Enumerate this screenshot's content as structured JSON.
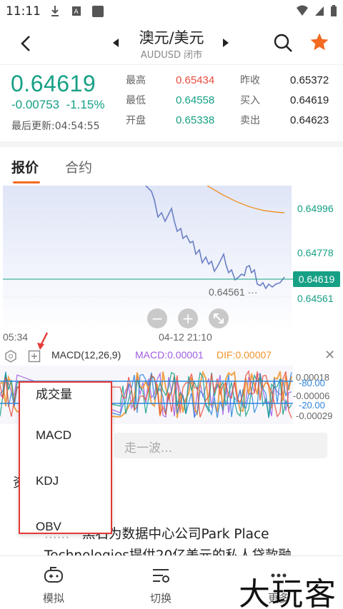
{
  "status": {
    "time": "11:11"
  },
  "header": {
    "title": "澳元/美元",
    "subtitle": "AUDUSD 闭市"
  },
  "quote": {
    "price": "0.64619",
    "change": "-0.00753",
    "change_pct": "-1.15%",
    "updated": "最后更新:04:54:55",
    "stats": [
      {
        "label": "最高",
        "value": "0.65434",
        "color": "red"
      },
      {
        "label": "最低",
        "value": "0.64558",
        "color": "green"
      },
      {
        "label": "开盘",
        "value": "0.65338",
        "color": "green"
      },
      {
        "label": "昨收",
        "value": "0.65372",
        "color": "dark"
      },
      {
        "label": "买入",
        "value": "0.64619",
        "color": "dark"
      },
      {
        "label": "卖出",
        "value": "0.64623",
        "color": "dark"
      }
    ]
  },
  "tabs": [
    {
      "label": "报价"
    },
    {
      "label": "合约"
    }
  ],
  "chart": {
    "price_labels": [
      "0.64996",
      "0.64778",
      "0.64561"
    ],
    "current_price": "0.64619",
    "low_label": "0.64561",
    "time_left": "05:34",
    "time_center": "04-12 21:10",
    "zoom_out": "−",
    "zoom_in": "+"
  },
  "macd": {
    "title": "MACD(12,26,9)",
    "macd_value": "MACD:0.00001",
    "dif_value": "DIF:0.00007",
    "axis": [
      "0.00018",
      "-80.00",
      "-0.00006",
      "-20.00",
      "-0.00029"
    ]
  },
  "dropdown": {
    "items": [
      "成交量",
      "MACD",
      "KDJ",
      "OBV"
    ]
  },
  "comment": {
    "placeholder": "走一波..."
  },
  "news": {
    "partial_left": "资",
    "line1": "黑石为数据中心公司Park Place",
    "line2": "Technologies提供20亿美元的私人贷款融"
  },
  "bottom_nav": [
    {
      "label": "模拟"
    },
    {
      "label": "切换"
    },
    {
      "label": "更多"
    }
  ],
  "watermark": "大玩客",
  "colors": {
    "accent": "#f36b21",
    "up": "#e74c3c",
    "down": "#16a085",
    "line": "#6a7fc4"
  }
}
